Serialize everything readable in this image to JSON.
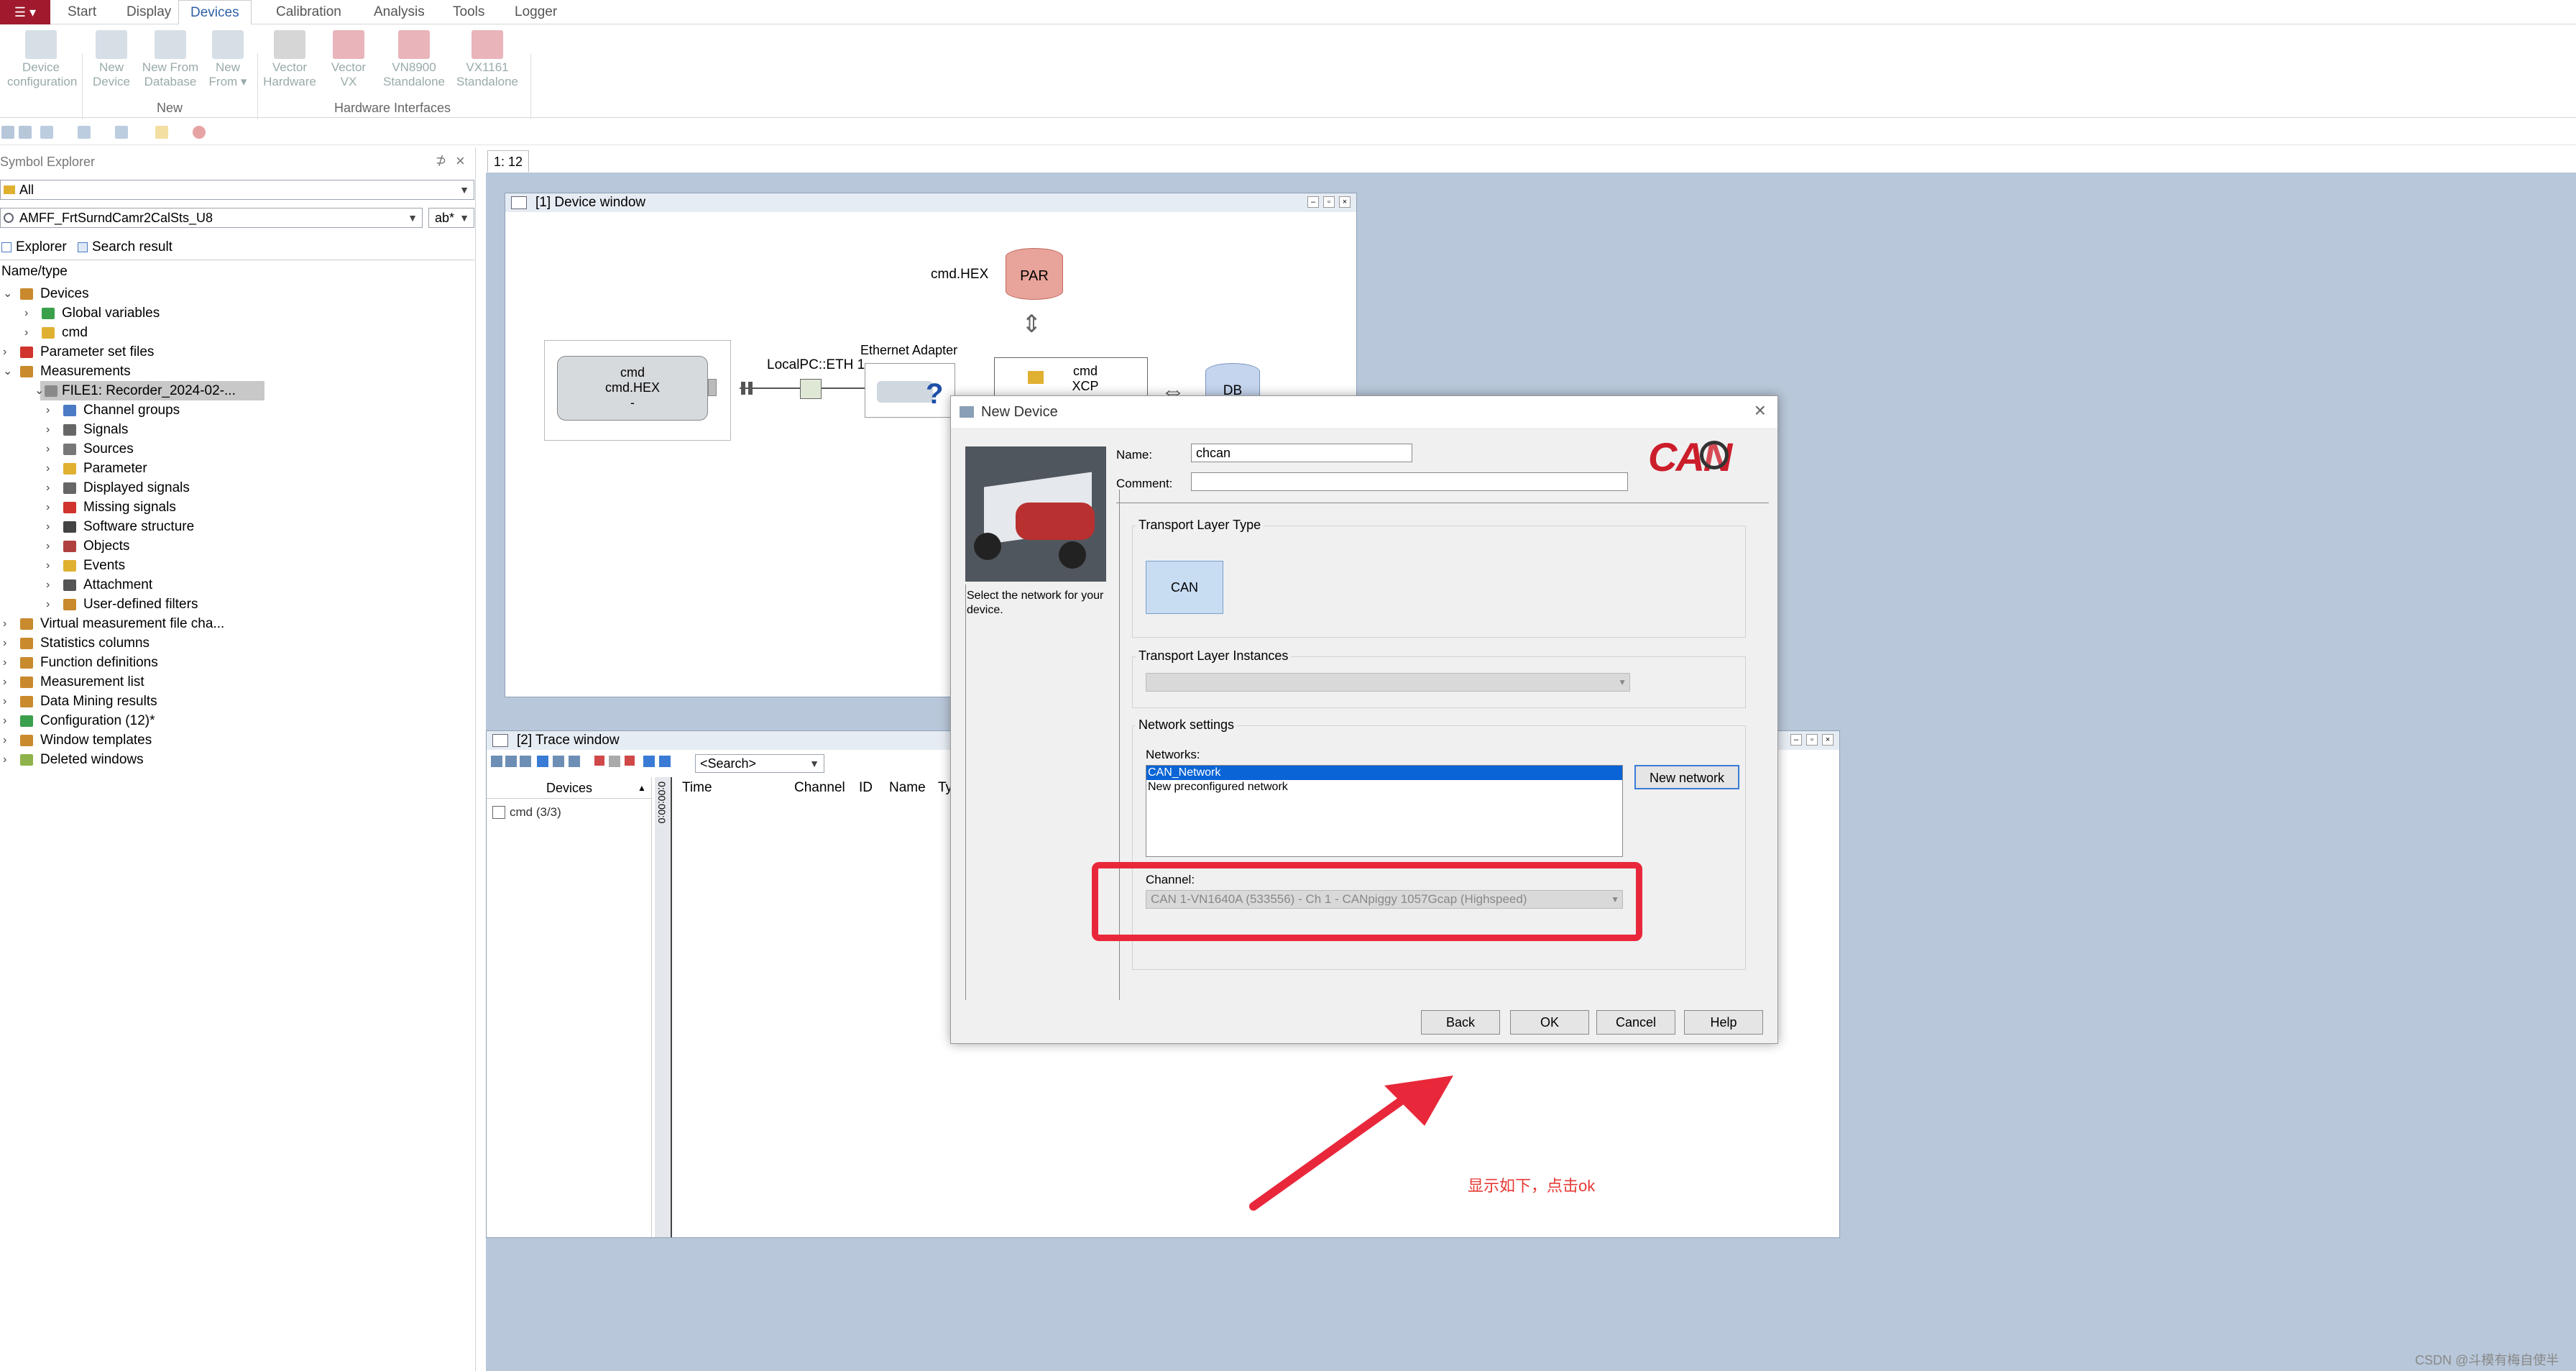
{
  "ribbon": {
    "app_menu": "☰ ▾",
    "tabs": [
      "Start",
      "Display",
      "Devices",
      "Calibration",
      "Analysis",
      "Tools",
      "Logger"
    ],
    "active_tab": "Devices",
    "buttons": [
      {
        "label1": "Device",
        "label2": "configuration"
      },
      {
        "label1": "New",
        "label2": "Device"
      },
      {
        "label1": "New From",
        "label2": "Database"
      },
      {
        "label1": "New",
        "label2": "From ▾"
      },
      {
        "label1": "Vector",
        "label2": "Hardware"
      },
      {
        "label1": "Vector",
        "label2": "VX"
      },
      {
        "label1": "VN8900",
        "label2": "Standalone"
      },
      {
        "label1": "VX1161",
        "label2": "Standalone"
      }
    ],
    "groups": [
      "New",
      "Hardware Interfaces"
    ]
  },
  "symbol_explorer": {
    "title": "Symbol Explorer",
    "pin": "⊅",
    "close": "×",
    "filter_value": "All",
    "search_value": "AMFF_FrtSurndCamr2CalSts_U8",
    "search_mode": "ab*",
    "subtabs": [
      "Explorer",
      "Search result"
    ],
    "header": "Name/type",
    "tree": [
      {
        "label": "Devices",
        "level": 0,
        "expanded": true,
        "icon": "#c98a2e"
      },
      {
        "label": "Global variables",
        "level": 1,
        "expanded": false,
        "icon": "#3aa04b"
      },
      {
        "label": "cmd",
        "level": 1,
        "expanded": false,
        "icon": "#e0b030"
      },
      {
        "label": "Parameter set files",
        "level": 0,
        "expanded": false,
        "icon": "#d0342c"
      },
      {
        "label": "Measurements",
        "level": 0,
        "expanded": true,
        "icon": "#c98a2e"
      },
      {
        "label": "FILE1: Recorder_2024-02-...",
        "level": 1,
        "expanded": true,
        "icon": "#8a8a8a",
        "selected": true
      },
      {
        "label": "Channel groups",
        "level": 2,
        "expanded": false,
        "icon": "#4a7bc4"
      },
      {
        "label": "Signals",
        "level": 2,
        "expanded": false,
        "icon": "#666666"
      },
      {
        "label": "Sources",
        "level": 2,
        "expanded": false,
        "icon": "#777777"
      },
      {
        "label": "Parameter",
        "level": 2,
        "expanded": false,
        "icon": "#e0b030"
      },
      {
        "label": "Displayed signals",
        "level": 2,
        "expanded": false,
        "icon": "#666666"
      },
      {
        "label": "Missing signals",
        "level": 2,
        "expanded": false,
        "icon": "#d0342c"
      },
      {
        "label": "Software structure",
        "level": 2,
        "expanded": false,
        "icon": "#444444"
      },
      {
        "label": "Objects",
        "level": 2,
        "expanded": false,
        "icon": "#b04040"
      },
      {
        "label": "Events",
        "level": 2,
        "expanded": false,
        "icon": "#e0b030"
      },
      {
        "label": "Attachment",
        "level": 2,
        "expanded": false,
        "icon": "#555555"
      },
      {
        "label": "User-defined filters",
        "level": 2,
        "expanded": false,
        "icon": "#c98a2e"
      },
      {
        "label": "Virtual measurement file cha...",
        "level": 0,
        "expanded": false,
        "icon": "#c98a2e"
      },
      {
        "label": "Statistics columns",
        "level": 0,
        "expanded": false,
        "icon": "#c98a2e"
      },
      {
        "label": "Function definitions",
        "level": 0,
        "expanded": false,
        "icon": "#c98a2e"
      },
      {
        "label": "Measurement list",
        "level": 0,
        "expanded": false,
        "icon": "#c98a2e"
      },
      {
        "label": "Data Mining results",
        "level": 0,
        "expanded": false,
        "icon": "#c98a2e"
      },
      {
        "label": "Configuration (12)*",
        "level": 0,
        "expanded": false,
        "icon": "#3aa04b"
      },
      {
        "label": "Window templates",
        "level": 0,
        "expanded": false,
        "icon": "#c98a2e"
      },
      {
        "label": "Deleted windows",
        "level": 0,
        "expanded": false,
        "icon": "#8fb24a"
      }
    ]
  },
  "doc_tab": "1: 12",
  "device_window": {
    "title": "[1] Device window",
    "ecu_line1": "cmd",
    "ecu_line2": "cmd.HEX",
    "ecu_line3": "-",
    "par_label": "PAR",
    "par_file": "cmd.HEX",
    "net_label": "LocalPC::ETH 1",
    "adapter_label": "Ethernet Adapter",
    "xcp_line1": "cmd",
    "xcp_line2": "XCP",
    "db_label": "DB"
  },
  "trace_window": {
    "title": "[2] Trace window",
    "search_placeholder": "<Search>",
    "devices_header": "Devices",
    "device_item": "cmd (3/3)",
    "time_readout": "0:00:00:0",
    "columns": [
      "Time",
      "Channel",
      "ID",
      "Name",
      "Ty"
    ]
  },
  "dialog": {
    "title": "New Device",
    "close": "×",
    "hint": "Select the network for your device.",
    "name_label": "Name:",
    "name_value": "chcan",
    "comment_label": "Comment:",
    "comment_value": "",
    "logo": "CAN",
    "transport_type_title": "Transport Layer Type",
    "transport_type_button": "CAN",
    "transport_instances_title": "Transport Layer Instances",
    "network_settings_title": "Network settings",
    "networks_label": "Networks:",
    "networks": [
      "CAN_Network",
      "New preconfigured network"
    ],
    "selected_network": "CAN_Network",
    "new_network_button": "New network",
    "channel_label": "Channel:",
    "channel_value": "CAN 1-VN1640A (533556) - Ch 1 - CANpiggy 1057Gcap (Highspeed)",
    "buttons": {
      "back": "Back",
      "ok": "OK",
      "cancel": "Cancel",
      "help": "Help"
    }
  },
  "annotation": {
    "text": "显示如下，点击ok",
    "color": "#e53935"
  },
  "watermark": "CSDN @斗模有梅自使半"
}
